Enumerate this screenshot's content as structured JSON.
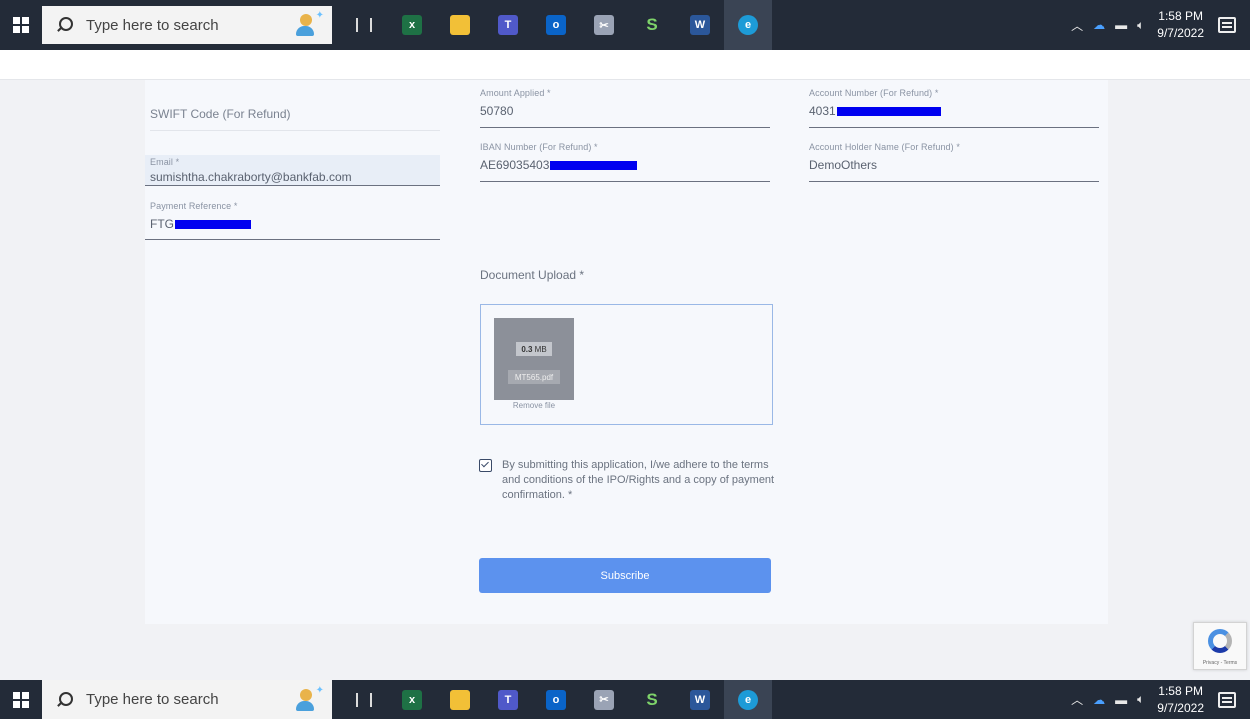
{
  "taskbar": {
    "search_placeholder": "Type here to search",
    "time": "1:58 PM",
    "date": "9/7/2022",
    "apps": [
      {
        "icon": "task-view-icon"
      },
      {
        "icon": "excel-icon",
        "color": "#1e7145",
        "glyph": "x"
      },
      {
        "icon": "file-explorer-icon",
        "color": "#f2c037",
        "glyph": ""
      },
      {
        "icon": "teams-icon",
        "color": "#5059c9",
        "glyph": "T"
      },
      {
        "icon": "outlook-icon",
        "color": "#0a64c8",
        "glyph": "o"
      },
      {
        "icon": "snipping-tool-icon",
        "color": "#9aa3b5",
        "glyph": "✂"
      },
      {
        "icon": "green-s-app-icon",
        "color": "#232b38",
        "glyph": "S"
      },
      {
        "icon": "word-icon",
        "color": "#2b579a",
        "glyph": "W"
      },
      {
        "icon": "edge-icon",
        "color": "#1d9bd7",
        "glyph": "e"
      }
    ]
  },
  "form": {
    "swift": {
      "placeholder": "SWIFT Code (For Refund)"
    },
    "email": {
      "label": "Email *",
      "value": "sumishtha.chakraborty@bankfab.com"
    },
    "payment_ref": {
      "label": "Payment Reference *",
      "value": "FTG"
    },
    "amount": {
      "label": "Amount Applied *",
      "value": "50780"
    },
    "iban": {
      "label": "IBAN Number (For Refund) *",
      "value": "AE69035403"
    },
    "account_number": {
      "label": "Account Number (For Refund) *",
      "value": "4031"
    },
    "account_holder": {
      "label": "Account Holder Name (For Refund) *",
      "value": "DemoOthers"
    },
    "upload": {
      "label": "Document Upload *",
      "file_size_num": "0.3",
      "file_size_unit": "MB",
      "file_name": "MT565.pdf",
      "remove_label": "Remove file"
    },
    "consent": {
      "checked": true,
      "text": "By submitting this application, I/we adhere to the terms and conditions of the IPO/Rights and a copy of payment confirmation. *"
    },
    "submit_label": "Subscribe"
  },
  "recaptcha": {
    "footer": "Privacy - Terms"
  },
  "colors": {
    "accent_button": "#5c92ee",
    "redaction": "#0000f0",
    "taskbar": "#232b38"
  }
}
